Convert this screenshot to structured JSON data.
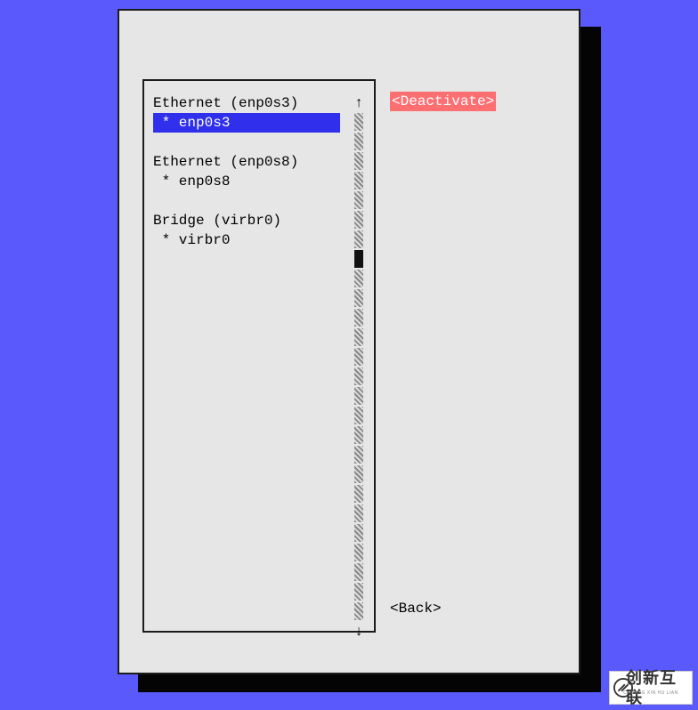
{
  "interfaces": {
    "groups": [
      {
        "header": "Ethernet (enp0s3)",
        "item": "* enp0s3",
        "selected": true
      },
      {
        "header": "Ethernet (enp0s8)",
        "item": "* enp0s8",
        "selected": false
      },
      {
        "header": "Bridge (virbr0)",
        "item": "* virbr0",
        "selected": false
      }
    ]
  },
  "buttons": {
    "deactivate": "<Deactivate>",
    "back": "<Back>"
  },
  "scroll": {
    "up": "↑",
    "down": "↓",
    "before_thumb": 7,
    "thumb": 1,
    "after_thumb": 18
  },
  "logo": {
    "text": "创新互联",
    "sub": "CHUANG XIN HU LIAN"
  }
}
